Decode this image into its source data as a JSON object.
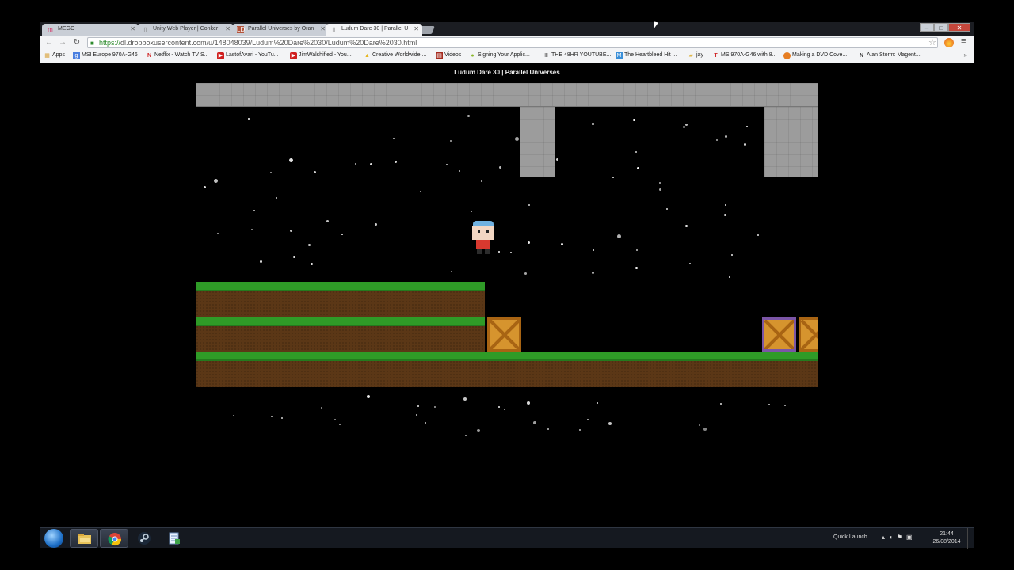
{
  "browser": {
    "tabs": [
      {
        "title": "MEGO",
        "favicon": "mega-icon"
      },
      {
        "title": "Unity Web Player | Conker",
        "favicon": "page-icon"
      },
      {
        "title": "Parallel Universes by Oran",
        "favicon": "ludum-dare-icon"
      },
      {
        "title": "Ludum Dare 30 | Parallel U",
        "favicon": "page-icon",
        "active": true
      }
    ],
    "window_controls": {
      "minimize": "–",
      "maximize": "□",
      "close": "✕"
    },
    "url": {
      "scheme": "https://",
      "rest": "dl.dropboxusercontent.com/u/148048039/Ludum%20Dare%2030/Ludum%20Dare%2030.html"
    },
    "bookmarks": [
      {
        "label": "Apps",
        "icon": "apps-grid-icon",
        "color": "#d9a23a"
      },
      {
        "label": "MSI Europe 970A-G46",
        "icon": "google-icon",
        "color": "#4a7fe0"
      },
      {
        "label": "Netflix - Watch TV S...",
        "icon": "netflix-icon",
        "color": "#d01f1f"
      },
      {
        "label": "LastofAvari - YouTu...",
        "icon": "youtube-icon",
        "color": "#d01f1f"
      },
      {
        "label": "JimWalshified - You...",
        "icon": "youtube-icon",
        "color": "#d01f1f"
      },
      {
        "label": "Creative Worldwide ...",
        "icon": "drive-icon",
        "color": "#e6b722"
      },
      {
        "label": "Videos",
        "icon": "film-icon",
        "color": "#a42a1e"
      },
      {
        "label": "Signing Your Applic...",
        "icon": "android-icon",
        "color": "#8ab72a"
      },
      {
        "label": "THE 48HR YOUTUBE...",
        "icon": "bars-icon",
        "color": "#555555"
      },
      {
        "label": "The Heartbleed Hit ...",
        "icon": "mashable-icon",
        "color": "#3a8fd8"
      },
      {
        "label": "jay",
        "icon": "folder-icon",
        "color": "#e0b84a"
      },
      {
        "label": "MSI970A-G46 with 8...",
        "icon": "t-icon",
        "color": "#d0282a"
      },
      {
        "label": "Making a DVD Cove...",
        "icon": "orange-circle-icon",
        "color": "#e67d22"
      },
      {
        "label": "Alan Storm: Magent...",
        "icon": "n-icon",
        "color": "#333333"
      }
    ]
  },
  "page": {
    "title": "Ludum Dare 30 | Parallel Universes"
  },
  "game": {
    "colors": {
      "grass": "#2f9b27",
      "dirt": "#5b3716",
      "stone": "#9c9c9c",
      "crate": "#d6942e"
    }
  },
  "taskbar": {
    "pinned": [
      {
        "name": "explorer",
        "icon": "folder-icon"
      },
      {
        "name": "chrome",
        "icon": "chrome-icon"
      },
      {
        "name": "steam",
        "icon": "steam-icon"
      },
      {
        "name": "notepad",
        "icon": "notepad-icon"
      }
    ],
    "quick_launch": "Quick Launch",
    "clock_time": "21:44",
    "clock_date": "26/08/2014"
  }
}
